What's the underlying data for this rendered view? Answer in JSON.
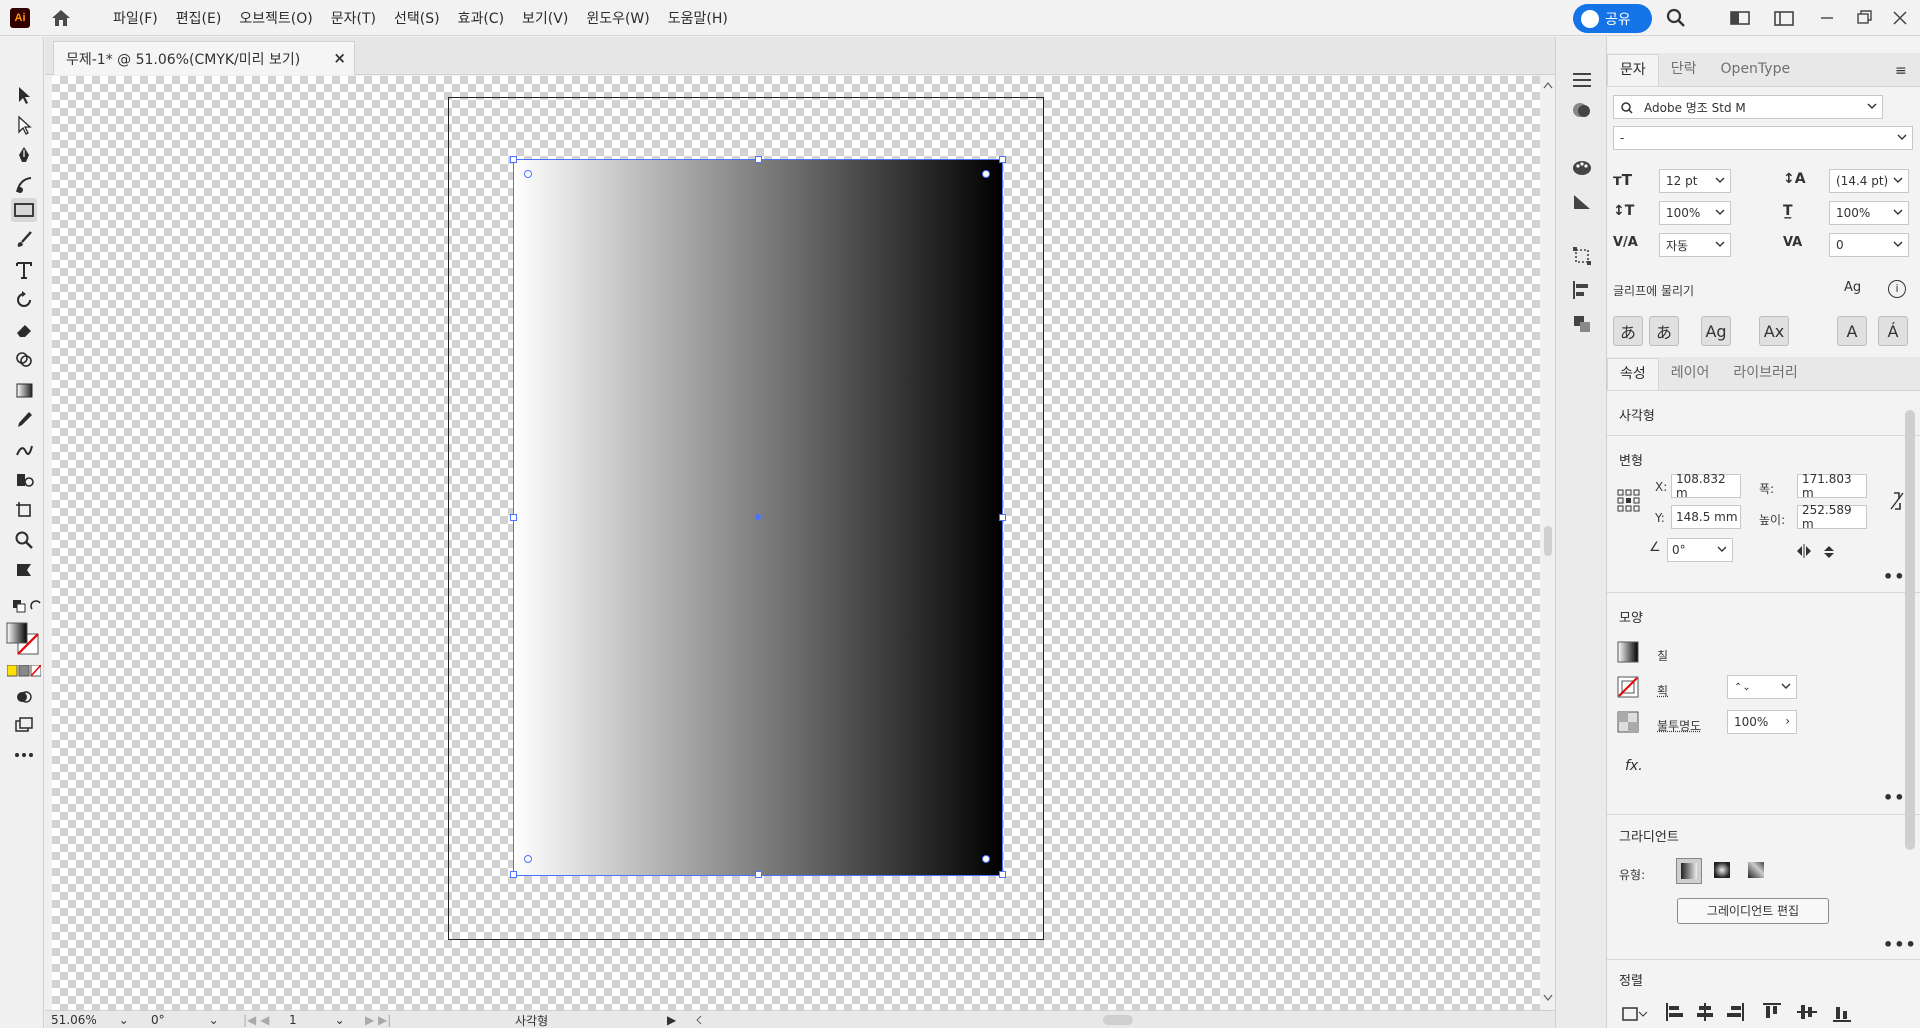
{
  "app": {
    "logo_text": "Ai"
  },
  "menu": [
    "파일(F)",
    "편집(E)",
    "오브젝트(O)",
    "문자(T)",
    "선택(S)",
    "효과(C)",
    "보기(V)",
    "윈도우(W)",
    "도움말(H)"
  ],
  "header": {
    "share_label": "공유"
  },
  "document": {
    "tab_title": "무제-1* @ 51.06%(CMYK/미리 보기)",
    "close_glyph": "×"
  },
  "status": {
    "zoom": "51.06%",
    "rotation": "0°",
    "page": "1",
    "selection_type": "사각형"
  },
  "character_panel": {
    "tabs": [
      "문자",
      "단락",
      "OpenType"
    ],
    "font_family": "Adobe 명조 Std M",
    "font_style": "-",
    "font_size": "12 pt",
    "leading": "(14.4 pt)",
    "vertical_scale": "100%",
    "horizontal_scale": "100%",
    "kerning": "자동",
    "tracking": "0",
    "snap_to_glyph": "글리프에 물리기",
    "glyph_buttons": [
      "あ",
      "あ",
      "Ag",
      "Ax",
      "A",
      "Á"
    ]
  },
  "properties_panel": {
    "tabs": [
      "속성",
      "레이어",
      "라이브러리"
    ],
    "object_type": "사각형",
    "transform": {
      "title": "변형",
      "x_label": "X:",
      "x_value": "108.832 m",
      "y_label": "Y:",
      "y_value": "148.5 mm",
      "w_label": "폭:",
      "w_value": "171.803 m",
      "h_label": "높이:",
      "h_value": "252.589 m",
      "angle_value": "0°"
    },
    "appearance": {
      "title": "모양",
      "fill_label": "칠",
      "stroke_label": "획",
      "opacity_label": "불투명도",
      "opacity_value": "100%",
      "fx_label": "fx."
    },
    "gradient": {
      "title": "그라디언트",
      "type_label": "유형:",
      "edit_button": "그레이디언트 편집"
    },
    "align": {
      "title": "정렬"
    }
  },
  "colors": {
    "accent": "#1473e6",
    "selection": "#4a74ff",
    "logo_bg": "#330000",
    "logo_fg": "#ff9a00"
  }
}
